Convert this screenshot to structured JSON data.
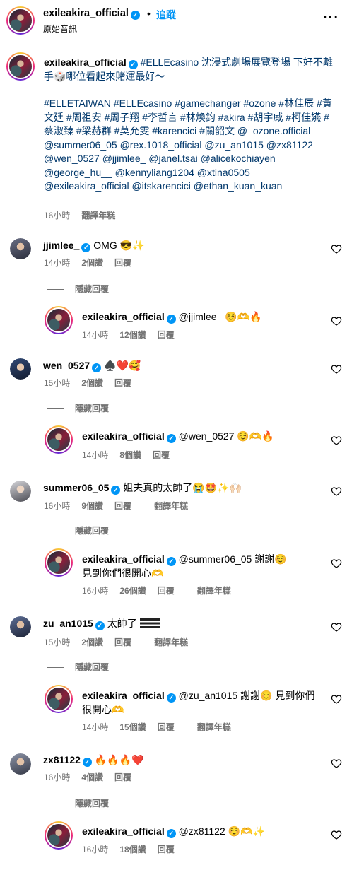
{
  "header": {
    "username": "exileakira_official",
    "separator": "•",
    "follow_label": "追蹤",
    "audio_label": "原始音訊",
    "more_icon": "more-horizontal-icon"
  },
  "post": {
    "username": "exileakira_official",
    "caption_line1": "#ELLEcasino 沈浸式劇場展覽登場 下好不離手🎲哪位看起來賭運最好～",
    "caption_tags": "#ELLETAIWAN #ELLEcasino #gamechanger #ozone #林佳辰 #黃文廷 #周祖安 #周子翔 #李哲言 #林煥鈞 #akira #胡宇威 #柯佳嬿 #蔡淑臻 #梁赫群 #莫允雯 #karencici #關韶文 @_ozone.official_ @summer06_05 @rex.1018_official @zu_an1015 @zx81122 @wen_0527 @jjimlee_ @janel.tsai @alicekochiayen @george_hu__ @kennyliang1204 @xtina0505 @exileakira_official @itskarencici @ethan_kuan_kuan",
    "time": "16小時",
    "translate": "翻譯年糕"
  },
  "comments": [
    {
      "username": "jjimlee_",
      "text": "OMG 😎✨",
      "time": "14小時",
      "likes": "2個讚",
      "reply": "回覆",
      "hidden": "隱藏回覆",
      "response": {
        "username": "exileakira_official",
        "text": "@jjimlee_ ☺️🫶🔥",
        "time": "14小時",
        "likes": "12個讚",
        "reply": "回覆"
      }
    },
    {
      "username": "wen_0527",
      "text": "♠️❤️🥰",
      "time": "15小時",
      "likes": "2個讚",
      "reply": "回覆",
      "hidden": "隱藏回覆",
      "response": {
        "username": "exileakira_official",
        "text": "@wen_0527 ☺️🫶🔥",
        "time": "14小時",
        "likes": "8個讚",
        "reply": "回覆"
      }
    },
    {
      "username": "summer06_05",
      "text": "姐夫真的太帥了😭🤩✨🙌🏻",
      "time": "16小時",
      "likes": "9個讚",
      "reply": "回覆",
      "translate": "翻譯年糕",
      "hidden": "隱藏回覆",
      "response": {
        "username": "exileakira_official",
        "text": "@summer06_05 謝謝☺️見到你們很開心🫶",
        "time": "16小時",
        "likes": "26個讚",
        "reply": "回覆",
        "translate": "翻譯年糕"
      }
    },
    {
      "username": "zu_an1015",
      "text": "太帥了",
      "time": "15小時",
      "likes": "2個讚",
      "reply": "回覆",
      "translate": "翻譯年糕",
      "hidden": "隱藏回覆",
      "response": {
        "username": "exileakira_official",
        "text": "@zu_an1015 謝謝☺️ 見到你們很開心🫶",
        "time": "14小時",
        "likes": "15個讚",
        "reply": "回覆",
        "translate": "翻譯年糕"
      }
    },
    {
      "username": "zx81122",
      "text": "🔥🔥🔥❤️",
      "time": "16小時",
      "likes": "4個讚",
      "reply": "回覆",
      "hidden": "隱藏回覆",
      "response": {
        "username": "exileakira_official",
        "text": "@zx81122 ☺️🫶✨",
        "time": "16小時",
        "likes": "18個讚",
        "reply": "回覆"
      }
    }
  ],
  "icons": {
    "verified": "verified-badge-icon",
    "heart": "heart-outline-icon",
    "more": "more-horizontal-icon"
  },
  "colors": {
    "accent": "#0095f6",
    "link": "#00376b",
    "muted": "#737373",
    "verified": "#0095f6"
  }
}
